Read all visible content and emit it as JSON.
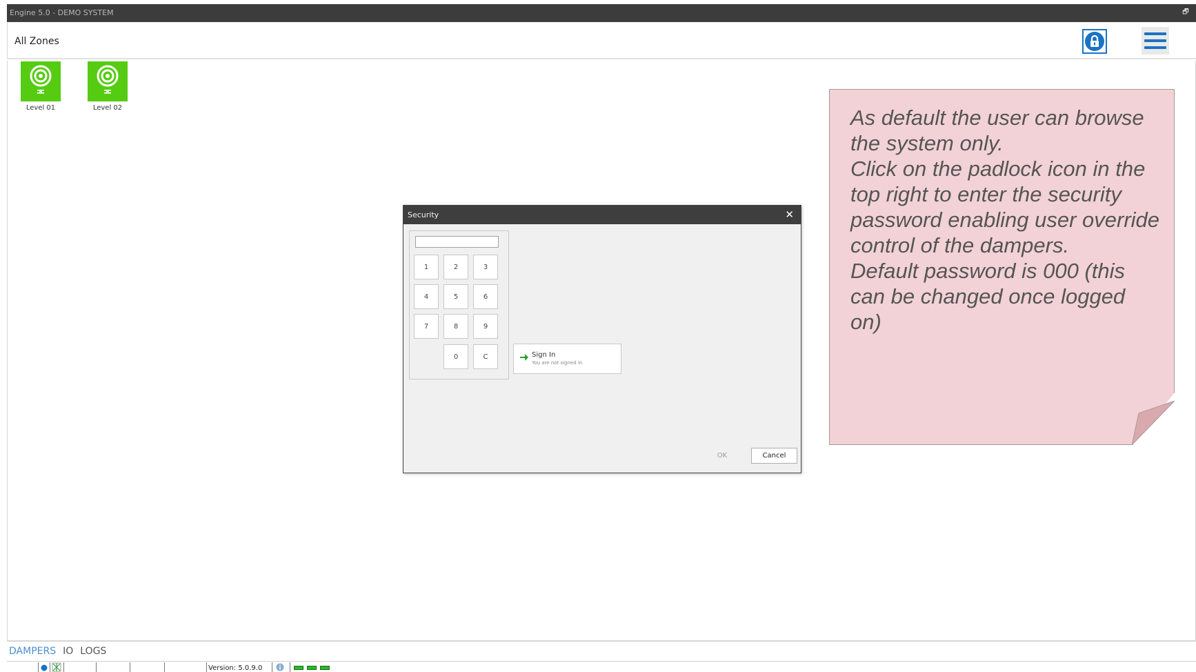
{
  "window": {
    "title": "Engine 5.0 - DEMO SYSTEM",
    "restore_glyph": "🗗"
  },
  "header": {
    "title": "All Zones",
    "lock_icon": "padlock-icon",
    "menu_icon": "hamburger-menu-icon"
  },
  "zones": [
    {
      "label": "Level 01",
      "icon": "target-icon"
    },
    {
      "label": "Level 02",
      "icon": "target-icon"
    }
  ],
  "note": {
    "text": "As default the user can browse the system only.\nClick on the padlock icon in the top right to enter the security password enabling user override control of the dampers.\nDefault password is 000 (this can be changed once logged on)"
  },
  "dialog": {
    "title": "Security",
    "close_glyph": "✕",
    "password_value": "",
    "keys": [
      "1",
      "2",
      "3",
      "4",
      "5",
      "6",
      "7",
      "8",
      "9",
      "0",
      "C"
    ],
    "signin": {
      "label": "Sign In",
      "status": "You are not signed in"
    },
    "ok_label": "OK",
    "cancel_label": "Cancel"
  },
  "tabs": [
    {
      "label": "DAMPERS",
      "active": true
    },
    {
      "label": "IO",
      "active": false
    },
    {
      "label": "LOGS",
      "active": false
    }
  ],
  "statusbar": {
    "version": "Version: 5.0.9.0"
  },
  "colors": {
    "accent": "#1a73c4",
    "zone_green": "#55cc11",
    "note_bg": "#f2d2d6",
    "titlebar": "#3c3c3c"
  }
}
